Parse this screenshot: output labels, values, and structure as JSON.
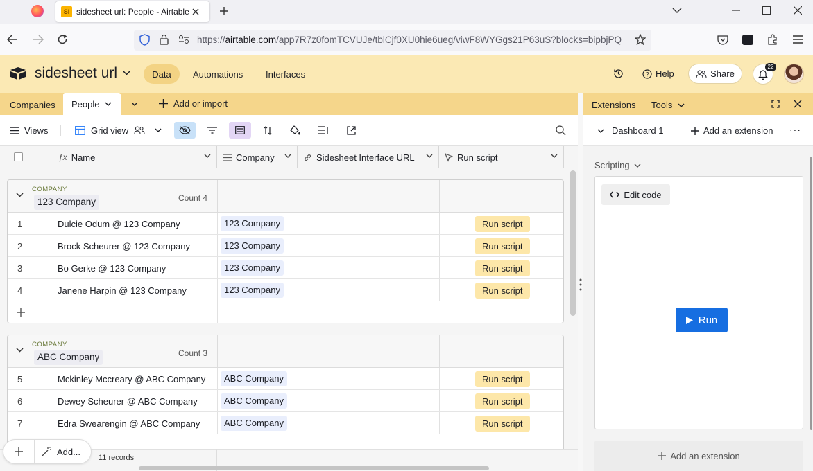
{
  "browser": {
    "tab_title": "sidesheet url: People - Airtable",
    "favicon_text": "Si",
    "url_prefix": "https://",
    "url_host": "airtable.com",
    "url_path": "/app7R7z0fomTCVUJe/tblCjf0XU0hie6ueg/viwF8WYGgs21P63uS?blocks=bipbjPQ"
  },
  "header": {
    "base_name": "sidesheet url",
    "nav": [
      "Data",
      "Automations",
      "Interfaces"
    ],
    "help": "Help",
    "share": "Share",
    "notifications": "22"
  },
  "tables": {
    "items": [
      "Companies",
      "People"
    ],
    "add_import": "Add or import"
  },
  "toolbar": {
    "views": "Views",
    "grid_view": "Grid view"
  },
  "columns": [
    "Name",
    "Company",
    "Sidesheet Interface URL",
    "Run script"
  ],
  "groups": [
    {
      "label": "COMPANY",
      "name": "123 Company",
      "count": "Count 4",
      "rows": [
        {
          "num": "1",
          "name": "Dulcie Odum @ 123 Company",
          "company": "123 Company",
          "action": "Run script"
        },
        {
          "num": "2",
          "name": "Brock Scheurer @ 123 Company",
          "company": "123 Company",
          "action": "Run script"
        },
        {
          "num": "3",
          "name": "Bo Gerke @ 123 Company",
          "company": "123 Company",
          "action": "Run script"
        },
        {
          "num": "4",
          "name": "Janene Harpin @ 123 Company",
          "company": "123 Company",
          "action": "Run script"
        }
      ]
    },
    {
      "label": "COMPANY",
      "name": "ABC Company",
      "count": "Count 3",
      "rows": [
        {
          "num": "5",
          "name": "Mckinley Mccreary @ ABC Company",
          "company": "ABC Company",
          "action": "Run script"
        },
        {
          "num": "6",
          "name": "Dewey Scheurer @ ABC Company",
          "company": "ABC Company",
          "action": "Run script"
        },
        {
          "num": "7",
          "name": "Edra Swearengin @ ABC Company",
          "company": "ABC Company",
          "action": "Run script"
        }
      ]
    }
  ],
  "footer": {
    "add_label": "Add...",
    "records": "11 records"
  },
  "extensions": {
    "tabs": [
      "Extensions",
      "Tools"
    ],
    "dashboard": "Dashboard 1",
    "add_extension": "Add an extension",
    "scripting": "Scripting",
    "edit_code": "Edit code",
    "run": "Run",
    "add_extension_bottom": "Add an extension"
  },
  "colors": {
    "header_bg": "#fbe9b4",
    "tabbar_bg": "#f5d68b",
    "run_button": "#166ee1",
    "run_script_button": "#fde7a9"
  }
}
